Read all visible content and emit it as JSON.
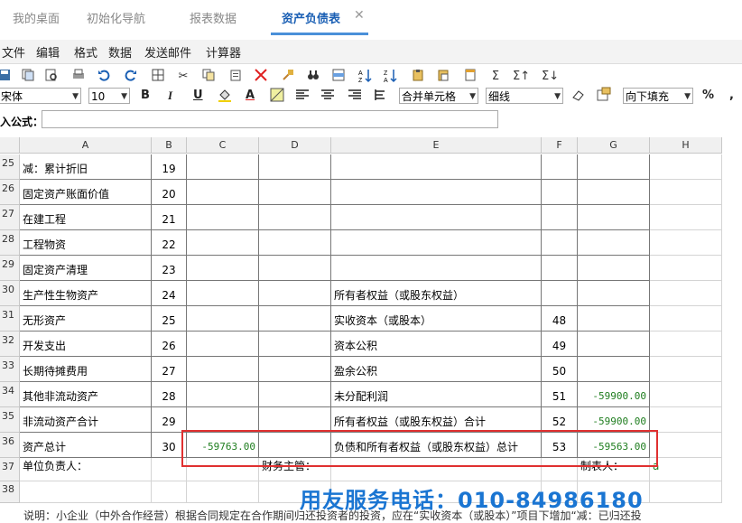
{
  "tabs": [
    {
      "label": "我的桌面",
      "active": false
    },
    {
      "label": "初始化导航",
      "active": false
    },
    {
      "label": "报表数据",
      "active": false
    },
    {
      "label": "资产负债表",
      "active": true
    }
  ],
  "tab_close": "✕",
  "menu": [
    "文件",
    "编辑",
    "格式",
    "数据",
    "发送邮件",
    "计算器"
  ],
  "toolbar2": {
    "font": "宋体",
    "size": "10",
    "bold": "B",
    "italic": "I",
    "underline": "U",
    "font_color": "A",
    "merge": "合并单元格",
    "line": "细线",
    "fill": "向下填充",
    "percent": "%",
    "comma": ","
  },
  "formula": {
    "label": "入公式：",
    "value": ""
  },
  "columns": [
    "A",
    "B",
    "C",
    "D",
    "E",
    "F",
    "G",
    "H"
  ],
  "rows": [
    {
      "n": "25",
      "a": "减：累计折旧",
      "b": "19",
      "e": "",
      "f": "",
      "g": "",
      "c": ""
    },
    {
      "n": "26",
      "a": "固定资产账面价值",
      "b": "20",
      "e": "",
      "f": "",
      "g": "",
      "c": ""
    },
    {
      "n": "27",
      "a": "在建工程",
      "b": "21",
      "e": "",
      "f": "",
      "g": "",
      "c": ""
    },
    {
      "n": "28",
      "a": "工程物资",
      "b": "22",
      "e": "",
      "f": "",
      "g": "",
      "c": ""
    },
    {
      "n": "29",
      "a": "固定资产清理",
      "b": "23",
      "e": "",
      "f": "",
      "g": "",
      "c": ""
    },
    {
      "n": "30",
      "a": "生产性生物资产",
      "b": "24",
      "e": "所有者权益（或股东权益）",
      "f": "",
      "g": "",
      "c": ""
    },
    {
      "n": "31",
      "a": "无形资产",
      "b": "25",
      "e": "实收资本（或股本）",
      "f": "48",
      "g": "",
      "c": ""
    },
    {
      "n": "32",
      "a": "开发支出",
      "b": "26",
      "e": "资本公积",
      "f": "49",
      "g": "",
      "c": ""
    },
    {
      "n": "33",
      "a": "长期待摊费用",
      "b": "27",
      "e": "盈余公积",
      "f": "50",
      "g": "",
      "c": ""
    },
    {
      "n": "34",
      "a": "其他非流动资产",
      "b": "28",
      "e": "未分配利润",
      "f": "51",
      "g": "-59900.00",
      "c": ""
    },
    {
      "n": "35",
      "a": "非流动资产合计",
      "b": "29",
      "e": "所有者权益（或股东权益）合计",
      "f": "52",
      "g": "-59900.00",
      "c": ""
    },
    {
      "n": "36",
      "a": "资产总计",
      "b": "30",
      "e": "负债和所有者权益（或股东权益）总计",
      "f": "53",
      "g": "-59563.00",
      "c": "-59763.00"
    }
  ],
  "row37": {
    "n": "37",
    "a": "单位负责人：",
    "d": "财务主管：",
    "g": "制表人：",
    "h": "a"
  },
  "row38": {
    "n": "38"
  },
  "watermark": "用友服务电话：010-84986180",
  "note": "说明：小企业（中外合作经营）根据合同规定在合作期间归还投资者的投资，应在“实收资本（或股本）”项目下增加“减：已归还投"
}
